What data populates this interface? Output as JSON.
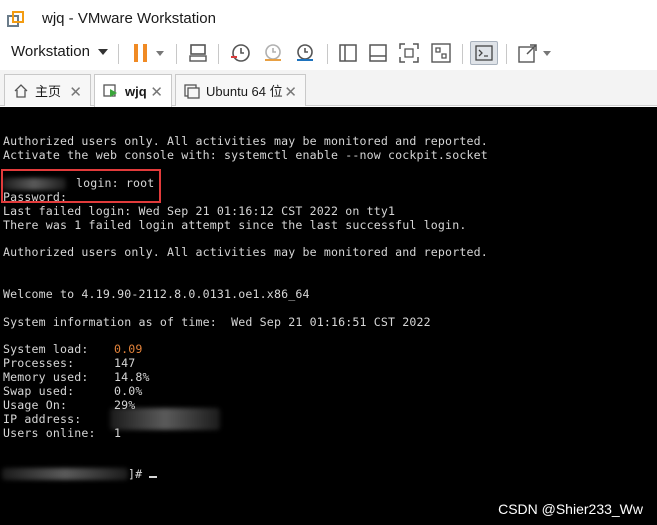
{
  "window": {
    "title": "wjq - VMware Workstation"
  },
  "toolbar": {
    "menu_label": "Workstation"
  },
  "tabs": [
    {
      "label": "主页",
      "icon": "home-icon"
    },
    {
      "label": "wjq",
      "icon": "vm-running-icon",
      "active": true
    },
    {
      "label": "Ubuntu 64 位",
      "icon": "vm-icon"
    }
  ],
  "console": {
    "lines": [
      "Authorized users only. All activities may be monitored and reported.",
      "Activate the web console with: systemctl enable --now cockpit.socket",
      "",
      "login: root",
      "Password:",
      "Last failed login: Wed Sep 21 01:16:12 CST 2022 on tty1",
      "There was 1 failed login attempt since the last successful login.",
      "",
      "Authorized users only. All activities may be monitored and reported.",
      "",
      "",
      "Welcome to 4.19.90-2112.8.0.0131.oe1.x86_64",
      "",
      "System information as of time:  Wed Sep 21 01:16:51 CST 2022"
    ],
    "stats": [
      {
        "label": "System load:",
        "value": "0.09",
        "highlight": true
      },
      {
        "label": "Processes:",
        "value": "147"
      },
      {
        "label": "Memory used:",
        "value": "14.8%"
      },
      {
        "label": "Swap used:",
        "value": "0.0%"
      },
      {
        "label": "Usage On:",
        "value": "29%"
      },
      {
        "label": "IP address:",
        "value": ""
      },
      {
        "label": "Users online:",
        "value": "1"
      }
    ],
    "prompt_suffix": "]# ",
    "highlight_color": "#e2823a"
  },
  "watermark": "CSDN @Shier233_Ww"
}
